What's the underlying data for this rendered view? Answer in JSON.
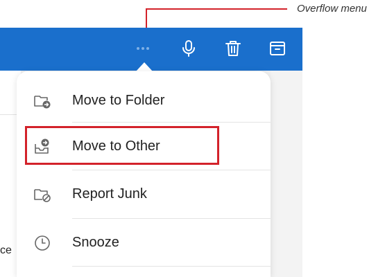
{
  "callout": {
    "label": "Overflow menu",
    "color": "#d3222a"
  },
  "toolbar": {
    "background": "#1a6fcc",
    "icons": [
      "more-horizontal-icon",
      "microphone-icon",
      "trash-icon",
      "archive-icon"
    ]
  },
  "menu": {
    "items": [
      {
        "label": "Move to Folder",
        "icon": "folder-move-icon"
      },
      {
        "label": "Move to Other",
        "icon": "inbox-move-icon",
        "highlighted": true
      },
      {
        "label": "Report Junk",
        "icon": "folder-block-icon"
      },
      {
        "label": "Snooze",
        "icon": "clock-icon"
      }
    ]
  },
  "background": {
    "partial_text": "ce"
  }
}
